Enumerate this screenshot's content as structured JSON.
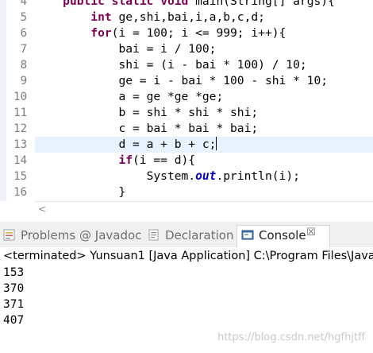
{
  "editor": {
    "line_numbers": [
      "4",
      "5",
      "6",
      "7",
      "8",
      "9",
      "10",
      "11",
      "12",
      "13",
      "14",
      "15",
      "16"
    ],
    "lines": [
      {
        "indent": "    ",
        "html_parts": [
          {
            "t": "kw",
            "v": "public"
          },
          {
            "t": "",
            "v": " "
          },
          {
            "t": "kw",
            "v": "static"
          },
          {
            "t": "",
            "v": " "
          },
          {
            "t": "kw",
            "v": "void"
          },
          {
            "t": "",
            "v": " main(String[] args){"
          }
        ]
      },
      {
        "indent": "        ",
        "html_parts": [
          {
            "t": "kw",
            "v": "int"
          },
          {
            "t": "",
            "v": " ge,shi,bai,i,a,b,c,d;"
          }
        ]
      },
      {
        "indent": "        ",
        "html_parts": [
          {
            "t": "kw",
            "v": "for"
          },
          {
            "t": "",
            "v": "(i = 100; i <= 999; i++){"
          }
        ]
      },
      {
        "indent": "            ",
        "html_parts": [
          {
            "t": "",
            "v": "bai = i / 100;"
          }
        ]
      },
      {
        "indent": "            ",
        "html_parts": [
          {
            "t": "",
            "v": "shi = (i - bai * 100) / 10;"
          }
        ]
      },
      {
        "indent": "            ",
        "html_parts": [
          {
            "t": "",
            "v": "ge = i - bai * 100 - shi * 10;"
          }
        ]
      },
      {
        "indent": "            ",
        "html_parts": [
          {
            "t": "",
            "v": "a = ge *ge *ge;"
          }
        ]
      },
      {
        "indent": "            ",
        "html_parts": [
          {
            "t": "",
            "v": "b = shi * shi * shi;"
          }
        ]
      },
      {
        "indent": "            ",
        "html_parts": [
          {
            "t": "",
            "v": "c = bai * bai * bai;"
          }
        ]
      },
      {
        "indent": "            ",
        "html_parts": [
          {
            "t": "",
            "v": "d = a + b + c;"
          }
        ],
        "current": true
      },
      {
        "indent": "            ",
        "html_parts": [
          {
            "t": "kw",
            "v": "if"
          },
          {
            "t": "",
            "v": "(i == d){"
          }
        ]
      },
      {
        "indent": "                ",
        "html_parts": [
          {
            "t": "",
            "v": "System."
          },
          {
            "t": "st",
            "v": "out"
          },
          {
            "t": "",
            "v": ".println(i);"
          }
        ]
      },
      {
        "indent": "            ",
        "html_parts": [
          {
            "t": "",
            "v": "}"
          }
        ]
      }
    ]
  },
  "tabs": [
    {
      "label": "Problems",
      "icon": "problems-icon"
    },
    {
      "label": "@ Javadoc",
      "icon": "javadoc-icon"
    },
    {
      "label": "Declaration",
      "icon": "declaration-icon"
    },
    {
      "label": "Console",
      "icon": "console-icon",
      "active": true
    }
  ],
  "close_symbol": "☒",
  "console": {
    "status": "<terminated> Yunsuan1 [Java Application] C:\\Program Files\\Java\\",
    "output": [
      "153",
      "370",
      "371",
      "407"
    ]
  },
  "watermark": "https://blog.csdn.net/hgfhjtff",
  "colors": {
    "keyword": "#7f0055",
    "static_field": "#0000c0",
    "current_line": "#e8f2fe"
  }
}
